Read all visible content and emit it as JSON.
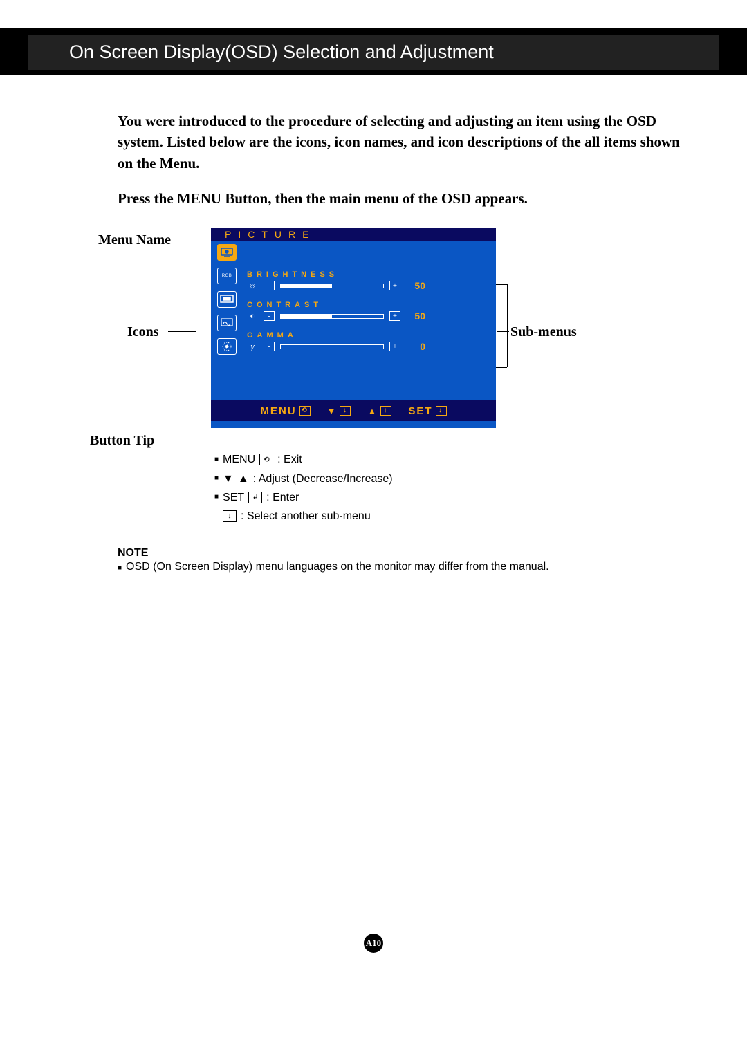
{
  "header": {
    "title": "On Screen Display(OSD) Selection and Adjustment"
  },
  "intro": {
    "p1": "You were introduced to the procedure of selecting and adjusting an item using the OSD system.  Listed below are the icons, icon names, and icon descriptions of the all items shown on the Menu.",
    "p2": "Press the MENU Button, then the main menu of the OSD appears."
  },
  "labels": {
    "menu_name": "Menu Name",
    "icons": "Icons",
    "button_tip": "Button Tip",
    "sub_menus": "Sub-menus"
  },
  "osd": {
    "title": "PICTURE",
    "submenus": [
      {
        "label": "BRIGHTNESS",
        "value": "50",
        "glyph": "☼",
        "fill": "half"
      },
      {
        "label": "CONTRAST",
        "value": "50",
        "glyph": "◐",
        "fill": "half"
      },
      {
        "label": "GAMMA",
        "value": "0",
        "glyph": "γ",
        "fill": "zero"
      }
    ],
    "footer": {
      "menu": "MENU",
      "set": "SET"
    }
  },
  "symbols": {
    "minus": "-",
    "plus": "+",
    "tri_down": "▼",
    "tri_up": "▲",
    "box_down": "↓",
    "box_up": "↑",
    "exit_glyph": "⟲",
    "enter_glyph": "↲"
  },
  "tips": {
    "menu_word": "MENU",
    "exit": " : Exit",
    "adjust": " : Adjust (Decrease/Increase)",
    "set_word": "SET",
    "enter": " : Enter",
    "select": " : Select another sub-menu"
  },
  "note": {
    "title": "NOTE",
    "text": "OSD (On Screen Display) menu languages on the monitor may differ from the manual."
  },
  "page": {
    "num": "A10"
  }
}
